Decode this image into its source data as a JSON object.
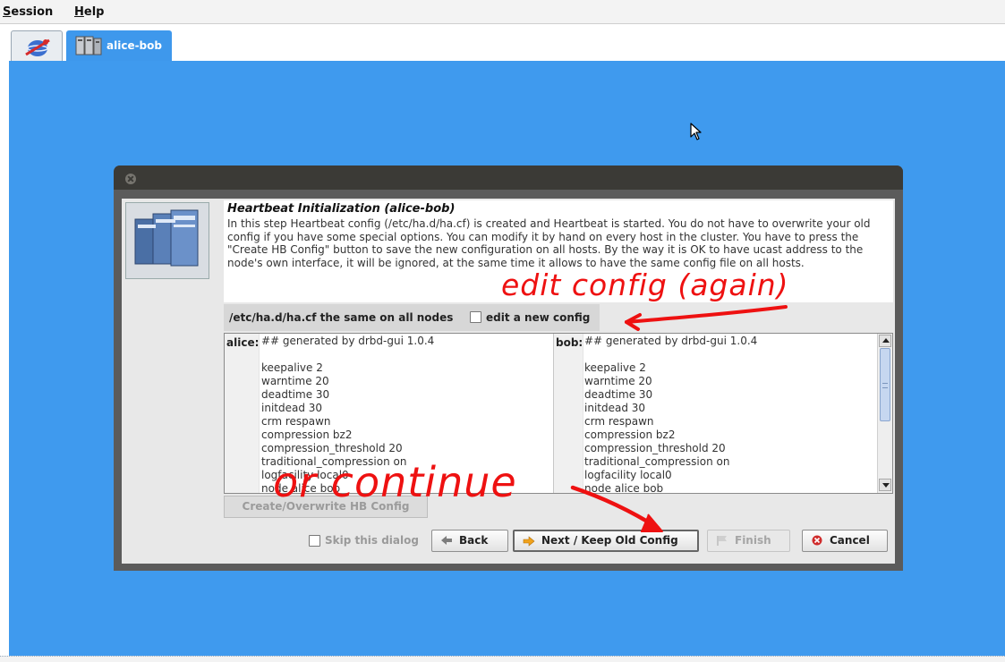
{
  "menubar": {
    "session": "Session",
    "help": "Help"
  },
  "tabs": [
    {
      "label": ""
    },
    {
      "label": "alice-bob"
    }
  ],
  "dialog": {
    "title": "Heartbeat Initialization (alice-bob)",
    "description": "In this step Heartbeat config (/etc/ha.d/ha.cf) is created and Heartbeat is started. You do not have to overwrite your old config if you have some special options. You can modify it by hand on every host in the cluster. You have to press the \"Create HB Config\" button to save the new configuration on all hosts. By the way it is OK to have ucast address to the node's own interface, it will be ignored, at the same time it allows to have the same config file on all hosts.",
    "config_same_label": "/etc/ha.d/ha.cf the same on all nodes",
    "edit_new_config_label": "edit a new config",
    "hosts": [
      {
        "label": "alice:",
        "lines": [
          "## generated by drbd-gui 1.0.4",
          "",
          "keepalive 2",
          "warntime 20",
          "deadtime 30",
          "initdead 30",
          "crm respawn",
          "compression bz2",
          "compression_threshold 20",
          "traditional_compression on",
          "logfacility local0",
          "node alice bob"
        ]
      },
      {
        "label": "bob:",
        "lines": [
          "## generated by drbd-gui 1.0.4",
          "",
          "keepalive 2",
          "warntime 20",
          "deadtime 30",
          "initdead 30",
          "crm respawn",
          "compression bz2",
          "compression_threshold 20",
          "traditional_compression on",
          "logfacility local0",
          "node alice bob"
        ]
      }
    ],
    "create_button": "Create/Overwrite HB Config",
    "skip_label": "Skip this dialog",
    "buttons": {
      "back": "Back",
      "next": "Next / Keep Old Config",
      "finish": "Finish",
      "cancel": "Cancel"
    }
  },
  "annotations": {
    "edit_config": "edit config (again)",
    "or_continue": "or continue"
  },
  "colors": {
    "desktop_blue": "#3f9aee",
    "annotation_red": "#ee1111"
  }
}
